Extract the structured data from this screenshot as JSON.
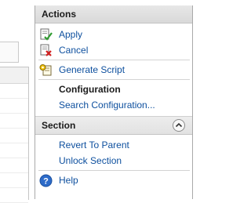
{
  "actions_pane": {
    "title": "Actions",
    "items": {
      "apply": "Apply",
      "cancel": "Cancel",
      "generate_script": "Generate Script"
    },
    "configuration": {
      "heading": "Configuration",
      "search": "Search Configuration..."
    },
    "section": {
      "title": "Section",
      "collapse_icon": "chevron-up-icon",
      "revert": "Revert To Parent",
      "unlock": "Unlock Section"
    },
    "help": "Help"
  },
  "icons": {
    "apply": "apply-checkmark-icon",
    "cancel": "cancel-x-icon",
    "generate_script": "generate-script-icon",
    "help": "help-icon"
  },
  "colors": {
    "link": "#0d4f9e",
    "header_bg": "#e0e0e0",
    "border": "#a9a9a9"
  }
}
